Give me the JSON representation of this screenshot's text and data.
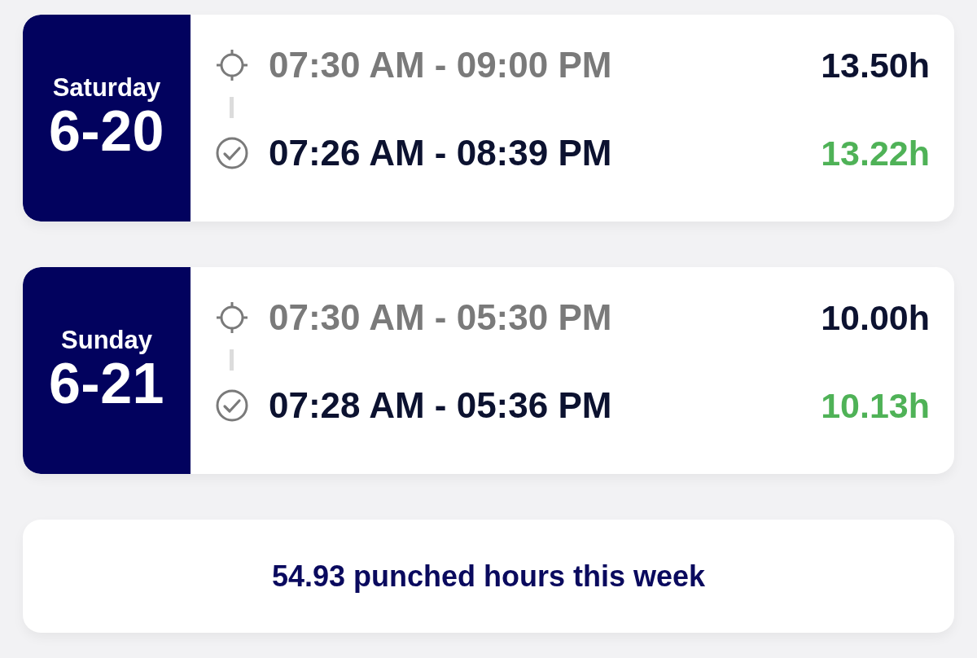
{
  "days": [
    {
      "weekday": "Saturday",
      "date": "6-20",
      "entries": [
        {
          "kind": "scheduled",
          "time_range": "07:30 AM - 09:00 PM",
          "hours": "13.50h"
        },
        {
          "kind": "punched",
          "time_range": "07:26 AM - 08:39 PM",
          "hours": "13.22h"
        }
      ]
    },
    {
      "weekday": "Sunday",
      "date": "6-21",
      "entries": [
        {
          "kind": "scheduled",
          "time_range": "07:30 AM - 05:30 PM",
          "hours": "10.00h"
        },
        {
          "kind": "punched",
          "time_range": "07:28 AM - 05:36 PM",
          "hours": "10.13h"
        }
      ]
    }
  ],
  "summary": {
    "text": "54.93 punched hours this week"
  }
}
